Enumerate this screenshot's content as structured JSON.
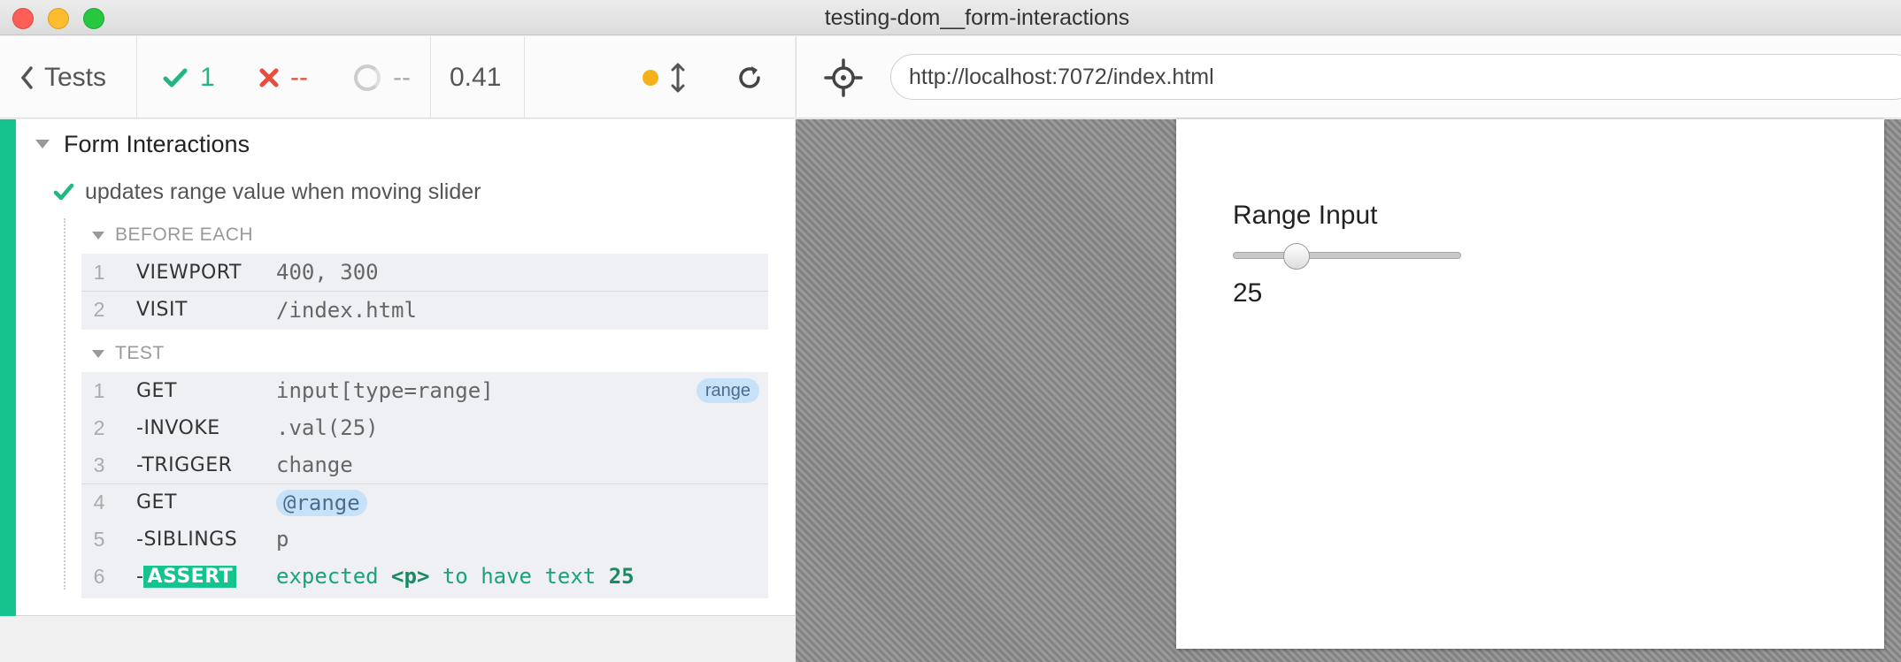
{
  "window": {
    "title": "testing-dom__form-interactions"
  },
  "toolbar": {
    "back_label": "Tests",
    "passed": "1",
    "failed": "--",
    "pending": "--",
    "duration": "0.41",
    "running_dot_color": "#f6b11a"
  },
  "url_bar": {
    "url": "http://localhost:7072/index.html"
  },
  "reporter": {
    "suite_title": "Form Interactions",
    "test_title": "updates range value when moving slider",
    "before_each": {
      "label": "BEFORE EACH",
      "commands": [
        {
          "num": "1",
          "name": "VIEWPORT",
          "message": "400, 300"
        },
        {
          "num": "2",
          "name": "VISIT",
          "message": "/index.html"
        }
      ]
    },
    "test": {
      "label": "TEST",
      "commands": [
        {
          "num": "1",
          "name": "GET",
          "message": "input[type=range]",
          "badge": "range"
        },
        {
          "num": "2",
          "name": "-INVOKE",
          "message": ".val(25)"
        },
        {
          "num": "3",
          "name": "-TRIGGER",
          "message": "change"
        },
        {
          "num": "4",
          "name": "GET",
          "message": "@range"
        },
        {
          "num": "5",
          "name": "-SIBLINGS",
          "message": "p"
        },
        {
          "num": "6",
          "name": "-",
          "name_highlight": "ASSERT",
          "message_parts": [
            "expected",
            "<p>",
            "to have text",
            "25"
          ]
        }
      ]
    }
  },
  "aut": {
    "label": "Range Input",
    "slider_value": 25,
    "slider_min": 0,
    "slider_max": 100,
    "value_text": "25"
  },
  "colors": {
    "pass": "#1fb880",
    "fail": "#e94c3d",
    "accent": "#14c38e"
  }
}
